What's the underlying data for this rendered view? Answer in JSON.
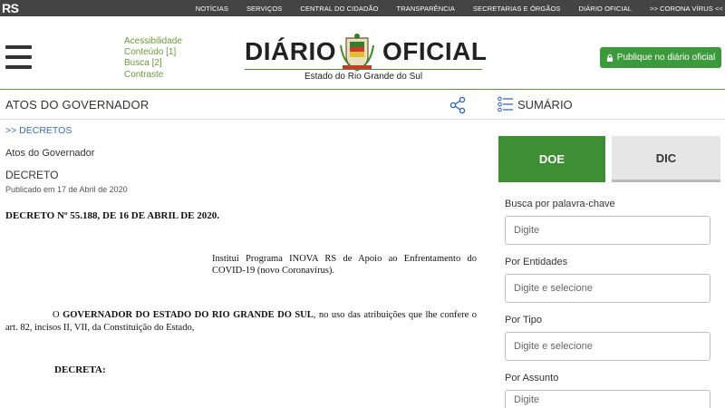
{
  "topbar": {
    "brand": "RS",
    "nav": [
      "NOTÍCIAS",
      "SERVIÇOS",
      "CENTRAL DO CIDADÃO",
      "TRANSPARÊNCIA",
      "SECRETARIAS E ÓRGÃOS",
      "DIÁRIO OFICIAL",
      ">> CORONA VÍRUS <<"
    ]
  },
  "accessibility": [
    "Acessibilidade",
    "Conteúdo [1]",
    "Busca [2]",
    "Contraste"
  ],
  "logo": {
    "word_left": "DIÁRIO",
    "word_right": "OFICIAL",
    "subtitle": "Estado do Rio Grande do Sul"
  },
  "publish_button": "Publique no diário oficial",
  "section": {
    "title": "ATOS DO GOVERNADOR",
    "summary": "SUMÁRIO"
  },
  "content": {
    "breadcrumb": ">> DECRETOS",
    "organ": "Atos do Governador",
    "kind": "DECRETO",
    "published": "Publicado em 17 de Abril de 2020",
    "doc_title": "DECRETO Nº 55.188, DE 16 DE ABRIL DE 2020.",
    "ementa": "Institui Programa INOVA RS de Apoio ao Enfrentamento do COVID-19 (novo Coronavírus).",
    "preamble_start": "O ",
    "preamble_bold": "GOVERNADOR DO ESTADO DO RIO GRANDE DO SUL",
    "preamble_end": ", no uso das atribuições que lhe confere o art. 82, incisos II, VII, da Constituição do Estado,",
    "decreta": "DECRETA:"
  },
  "sidebar": {
    "tab_doe": "DOE",
    "tab_dic": "DIC",
    "filters": [
      {
        "label": "Busca por palavra-chave",
        "placeholder": "Digite"
      },
      {
        "label": "Por Entidades",
        "placeholder": "Digite e selecione"
      },
      {
        "label": "Por Tipo",
        "placeholder": "Digite e selecione"
      },
      {
        "label": "Por Assunto",
        "placeholder": "Digite"
      }
    ]
  },
  "colors": {
    "accent_green": "#3e8e33",
    "link_blue": "#3a6cc0",
    "topbar": "#444444"
  }
}
